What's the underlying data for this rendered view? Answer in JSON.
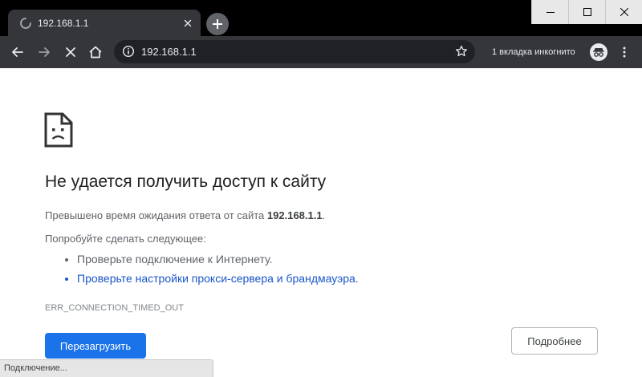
{
  "window": {
    "controls": [
      "minimize",
      "maximize",
      "close"
    ]
  },
  "tab": {
    "title": "192.168.1.1",
    "loading": true
  },
  "toolbar": {
    "url": "192.168.1.1",
    "incognito_label": "1 вкладка инкогнито"
  },
  "page": {
    "headline": "Не удается получить доступ к сайту",
    "summary_prefix": "Превышено время ожидания ответа от сайта ",
    "summary_host": "192.168.1.1",
    "summary_suffix": ".",
    "try_label": "Попробуйте сделать следующее:",
    "suggestions": [
      {
        "text": "Проверьте подключение к Интернету.",
        "link": false
      },
      {
        "text": "Проверьте настройки прокси-сервера и брандмауэра.",
        "link": true
      }
    ],
    "error_code": "ERR_CONNECTION_TIMED_OUT",
    "reload_label": "Перезагрузить",
    "details_label": "Подробнее"
  },
  "status": {
    "text": "Подключение..."
  },
  "colors": {
    "titlebar": "#000000",
    "toolbar": "#35363a",
    "omnibox": "#202124",
    "primary_button": "#1a73e8",
    "link": "#1a56c9"
  }
}
